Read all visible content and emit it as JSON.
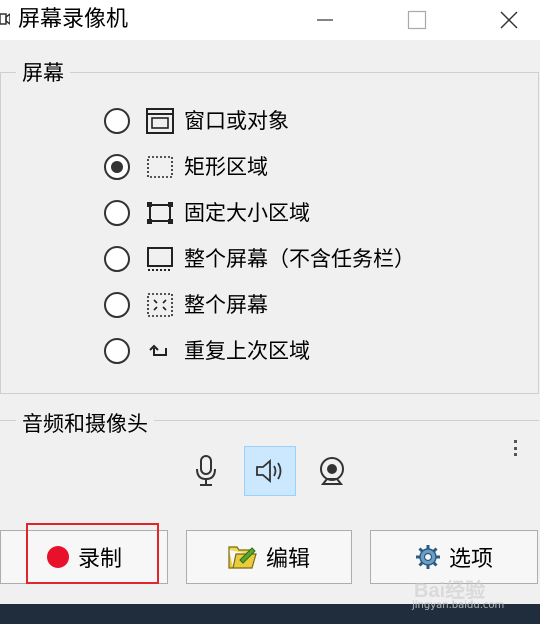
{
  "window": {
    "title": "屏幕录像机",
    "minimize_icon": "minimize-icon",
    "maximize_icon": "maximize-icon",
    "close_icon": "close-icon"
  },
  "screen_group": {
    "label": "屏幕",
    "selected_index": 1,
    "options": [
      {
        "label": "窗口或对象",
        "icon": "window-icon"
      },
      {
        "label": "矩形区域",
        "icon": "dashed-rect-icon"
      },
      {
        "label": "固定大小区域",
        "icon": "fixed-size-icon"
      },
      {
        "label": "整个屏幕（不含任务栏）",
        "icon": "screen-no-taskbar-icon"
      },
      {
        "label": "整个屏幕",
        "icon": "fullscreen-icon"
      },
      {
        "label": "重复上次区域",
        "icon": "repeat-icon"
      }
    ]
  },
  "av_group": {
    "label": "音频和摄像头",
    "buttons": [
      {
        "icon": "microphone-icon",
        "active": false
      },
      {
        "icon": "speaker-icon",
        "active": true
      },
      {
        "icon": "webcam-icon",
        "active": false
      }
    ]
  },
  "actions": {
    "record_label": "录制",
    "edit_label": "编辑",
    "options_label": "选项"
  },
  "watermark": {
    "brand": "Bai经验",
    "url": "jingyan.baidu.com"
  },
  "colors": {
    "record_dot": "#e8102a",
    "highlight_border": "#e0262b",
    "selected_button_bg": "#cce8ff"
  }
}
